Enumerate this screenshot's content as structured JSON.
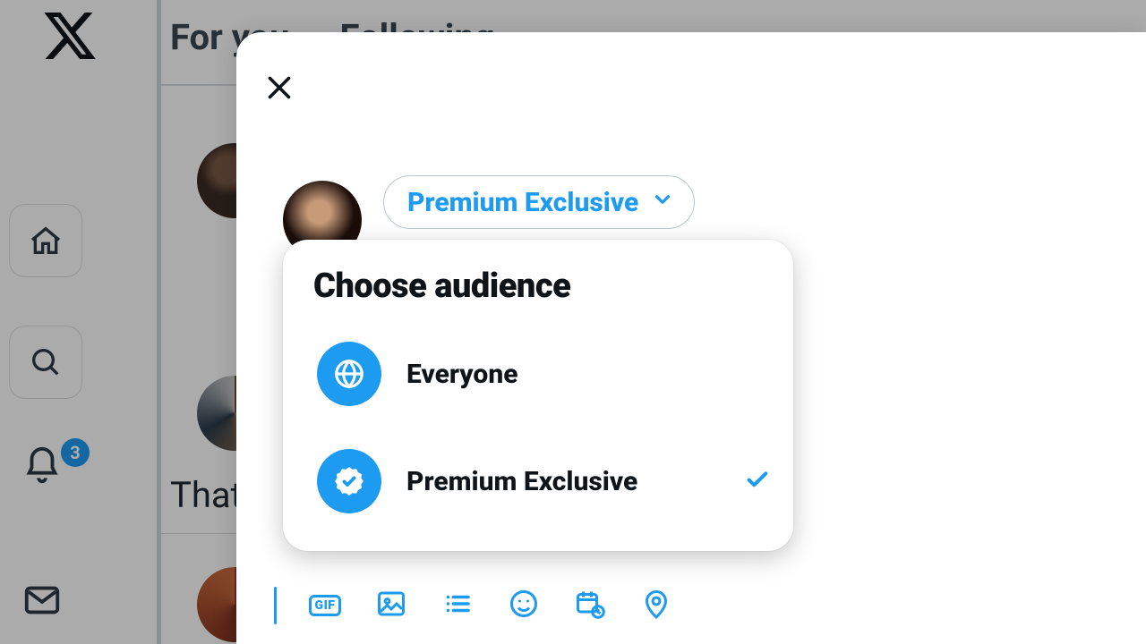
{
  "rail": {
    "notification_count": "3"
  },
  "feed": {
    "tabs": [
      "For you",
      "Following"
    ],
    "snippet": "That"
  },
  "composer": {
    "audience_pill_label": "Premium Exclusive",
    "dropdown": {
      "title": "Choose audience",
      "options": [
        {
          "label": "Everyone",
          "selected": false
        },
        {
          "label": "Premium Exclusive",
          "selected": true
        }
      ]
    },
    "toolbar": {
      "gif_label": "GIF"
    }
  }
}
